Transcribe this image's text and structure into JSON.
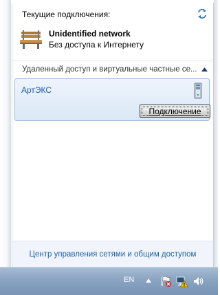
{
  "current_connections": {
    "header": "Текущие подключения:",
    "network": {
      "name": "Unidentified network",
      "status": "Без доступа к Интернету",
      "icon": "park-bench-icon"
    },
    "refresh_icon": "refresh-arrows-icon"
  },
  "vpn_section": {
    "header": "Удаленный доступ и виртуальные частные се...",
    "collapse_icon": "chevron-up-icon",
    "items": [
      {
        "name": "АртЭКС",
        "icon": "vpn-server-icon",
        "button_label": "Подключение",
        "selected": true
      }
    ]
  },
  "footer": {
    "link": "Центр управления сетями и общим доступом"
  },
  "taskbar": {
    "language": "EN",
    "tray_icons": [
      "show-hidden-icons-arrow",
      "action-center-flag-icon",
      "network-warning-icon",
      "volume-icon"
    ]
  },
  "colors": {
    "link_blue": "#1f5fa8",
    "selected_bg": "#dae7f6",
    "selected_border": "#9cb8d9",
    "taskbar": "#8aa4c2"
  }
}
